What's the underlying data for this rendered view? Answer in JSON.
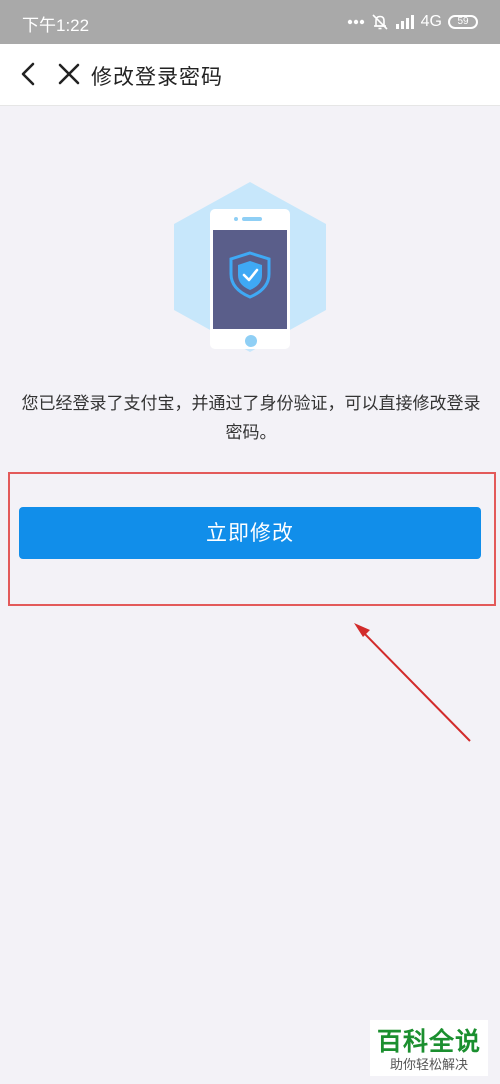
{
  "status_bar": {
    "time": "下午1:22",
    "network": "4G",
    "battery": "59",
    "icons": [
      "more-dots-icon",
      "alarm-off-icon",
      "signal-icon",
      "battery-icon"
    ]
  },
  "nav": {
    "title": "修改登录密码",
    "back_icon": "back-arrow-icon",
    "close_icon": "close-icon"
  },
  "main": {
    "illustration_icon": "phone-shield-icon",
    "description": "您已经登录了支付宝，并通过了身份验证，可以直接修改登录密码。",
    "button_label": "立即修改"
  },
  "colors": {
    "status_bar_bg": "#a9a9a9",
    "page_bg": "#f3f2f7",
    "primary": "#118eea",
    "annotation": "#e35a5a"
  },
  "watermark": {
    "title": "百科全说",
    "subtitle": "助你轻松解决"
  }
}
